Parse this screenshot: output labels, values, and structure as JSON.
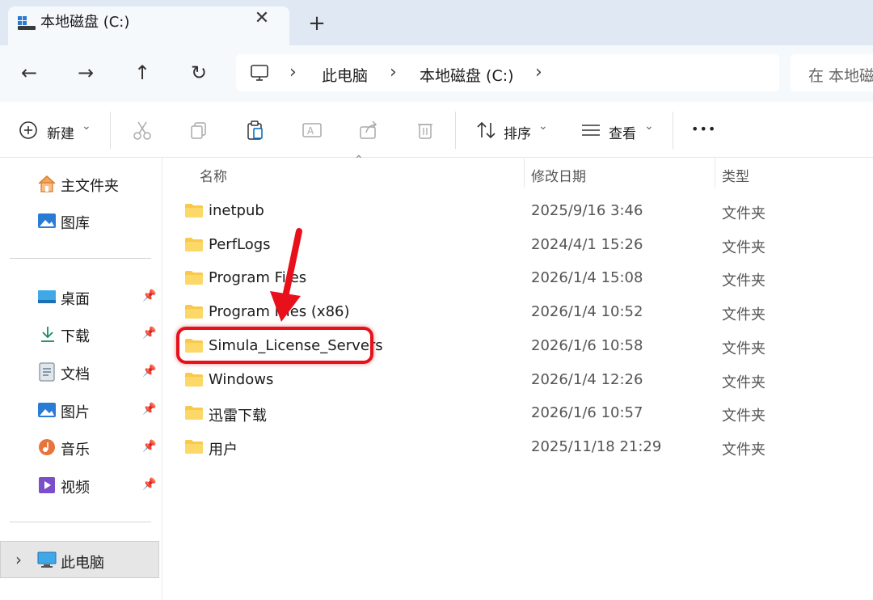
{
  "tab": {
    "title": "本地磁盘 (C:)",
    "close": "✕",
    "new_tab": "+"
  },
  "nav": {
    "back": "←",
    "forward": "→",
    "up": "↑",
    "refresh": "↻"
  },
  "breadcrumb": {
    "sep": "›",
    "items": [
      "此电脑",
      "本地磁盘 (C:)"
    ]
  },
  "search": {
    "text": "在 本地磁"
  },
  "toolbar": {
    "new_label": "新建",
    "sort_label": "排序",
    "view_label": "查看",
    "more": "•••",
    "chevron": "⌄"
  },
  "sidebar": {
    "home": "主文件夹",
    "gallery": "图库",
    "quick": [
      {
        "label": "桌面"
      },
      {
        "label": "下载"
      },
      {
        "label": "文档"
      },
      {
        "label": "图片"
      },
      {
        "label": "音乐"
      },
      {
        "label": "视频"
      }
    ],
    "this_pc": "此电脑",
    "expand": "›",
    "pin": "📌"
  },
  "columns": {
    "name": "名称",
    "date": "修改日期",
    "type": "类型",
    "sort_arrow": "⌃"
  },
  "files": [
    {
      "name": "inetpub",
      "date": "2025/9/16 3:46",
      "type": "文件夹"
    },
    {
      "name": "PerfLogs",
      "date": "2024/4/1 15:26",
      "type": "文件夹"
    },
    {
      "name": "Program Files",
      "date": "2026/1/4 15:08",
      "type": "文件夹"
    },
    {
      "name": "Program Files (x86)",
      "date": "2026/1/4 10:52",
      "type": "文件夹"
    },
    {
      "name": "Simula_License_Servers",
      "date": "2026/1/6 10:58",
      "type": "文件夹"
    },
    {
      "name": "Windows",
      "date": "2026/1/4 12:26",
      "type": "文件夹"
    },
    {
      "name": "迅雷下载",
      "date": "2026/1/6 10:57",
      "type": "文件夹"
    },
    {
      "name": "用户",
      "date": "2025/11/18 21:29",
      "type": "文件夹"
    }
  ],
  "colors": {
    "accent": "#0067c0",
    "folder": "#f8c94a",
    "highlight": "#e8101a"
  }
}
